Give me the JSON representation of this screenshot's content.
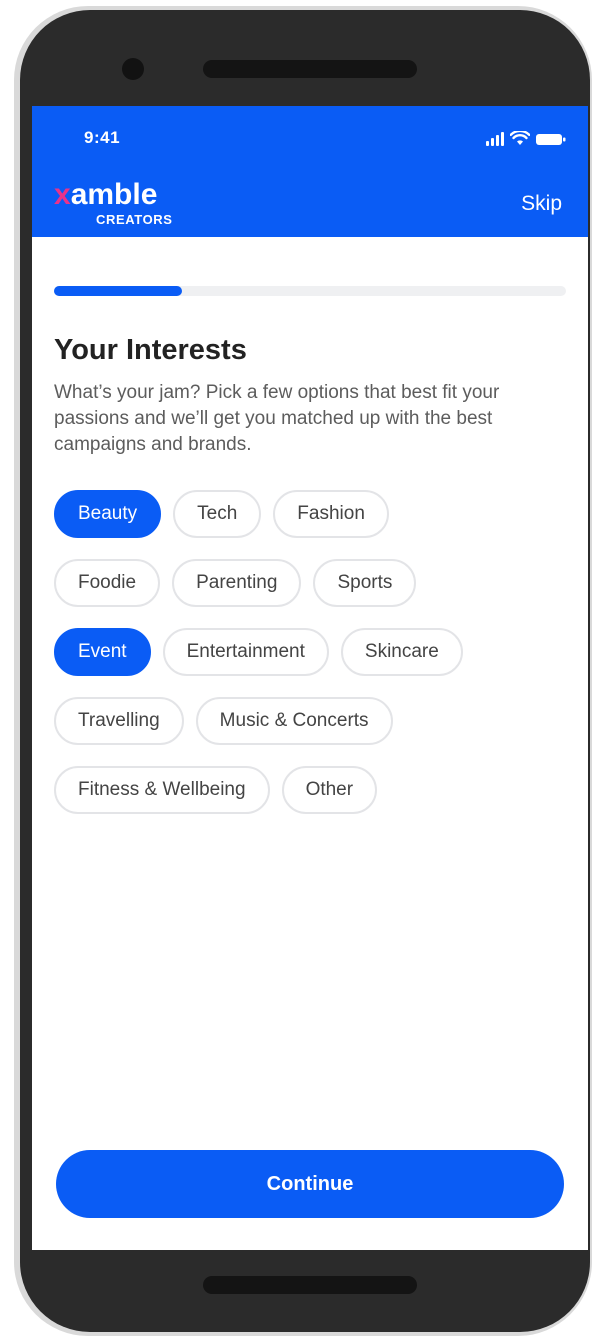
{
  "status_bar": {
    "time": "9:41",
    "icons": [
      "signal-icon",
      "wifi-icon",
      "battery-icon"
    ]
  },
  "header": {
    "logo": {
      "mark": "x",
      "word": "amble",
      "subtitle": "CREATORS"
    },
    "skip_label": "Skip"
  },
  "progress": {
    "value": 0.25
  },
  "page": {
    "title": "Your Interests",
    "description": "What’s your jam? Pick a few options that best fit your passions and we’ll get you matched up with the best campaigns and brands."
  },
  "interests": {
    "rows": [
      [
        {
          "label": "Beauty",
          "selected": true
        },
        {
          "label": "Tech",
          "selected": false
        },
        {
          "label": "Fashion",
          "selected": false
        }
      ],
      [
        {
          "label": "Foodie",
          "selected": false
        },
        {
          "label": "Parenting",
          "selected": false
        },
        {
          "label": "Sports",
          "selected": false
        }
      ],
      [
        {
          "label": "Event",
          "selected": true
        },
        {
          "label": "Entertainment",
          "selected": false
        },
        {
          "label": "Skincare",
          "selected": false
        }
      ],
      [
        {
          "label": "Travelling",
          "selected": false
        },
        {
          "label": "Music & Concerts",
          "selected": false
        }
      ],
      [
        {
          "label": "Fitness & Wellbeing",
          "selected": false
        },
        {
          "label": "Other",
          "selected": false
        }
      ]
    ]
  },
  "footer": {
    "continue_label": "Continue"
  },
  "colors": {
    "primary": "#0a5cf5",
    "brand_accent": "#e8338a",
    "chip_border": "#e3e4e7",
    "phone_frame": "#2b2b2b"
  }
}
